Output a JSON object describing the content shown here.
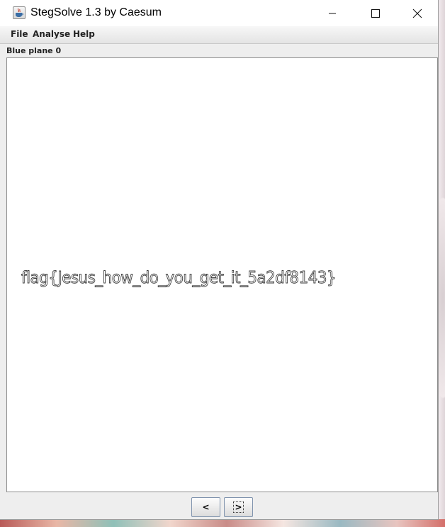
{
  "window": {
    "title": "StegSolve 1.3 by Caesum",
    "app_icon": "java-coffee-cup-icon",
    "controls": [
      "minimize-icon",
      "maximize-icon",
      "close-icon"
    ]
  },
  "menu": {
    "items": [
      {
        "label": "File"
      },
      {
        "label": "Analyse"
      },
      {
        "label": "Help"
      }
    ]
  },
  "viewer": {
    "plane_label": "Blue plane 0",
    "image_text": "flag{Jesus_how_do_you_get_it_5a2df8143}"
  },
  "navigation": {
    "prev_label": "<",
    "next_label": ">"
  },
  "colors": {
    "window_bg": "#eeeeee",
    "titlebar_bg": "#ffffff",
    "panel_bg": "#ffffff",
    "button_border": "#7f93ad"
  }
}
